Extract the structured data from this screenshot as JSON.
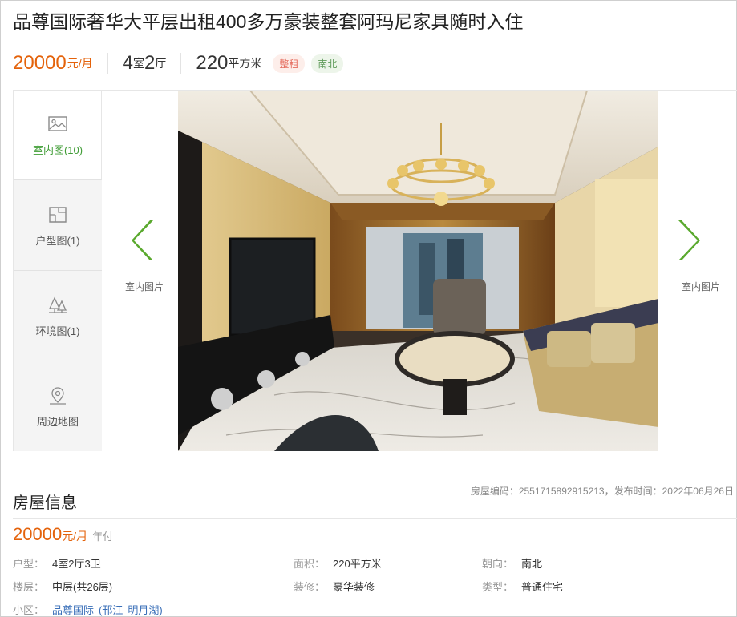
{
  "listing": {
    "title": "品尊国际奢华大平层出租400多万豪装整套阿玛尼家具随时入住",
    "price": "20000",
    "price_unit": "元/月",
    "rooms_num": "4",
    "rooms_unit1": "室",
    "halls_num": "2",
    "halls_unit": "厅",
    "area_num": "220",
    "area_unit": "平方米",
    "tags": [
      "整租",
      "南北"
    ]
  },
  "gallery": {
    "tabs": [
      {
        "label": "室内图(10)",
        "icon": "image-icon",
        "active": true
      },
      {
        "label": "户型图(1)",
        "icon": "floorplan-icon",
        "active": false
      },
      {
        "label": "环境图(1)",
        "icon": "trees-icon",
        "active": false
      },
      {
        "label": "周边地图",
        "icon": "map-pin-icon",
        "active": false
      }
    ],
    "prev_caption": "室内图片",
    "next_caption": "室内图片",
    "arrow_color": "#5aa92e",
    "photo_alt": "客厅室内照片"
  },
  "info": {
    "section_title": "房屋信息",
    "meta": "房屋编码：2551715892915213，发布时间：2022年06月26日",
    "price": "20000",
    "price_unit": "元/月",
    "pay_method": "年付",
    "rows": [
      [
        {
          "key": "户型：",
          "value": "4室2厅3卫"
        },
        {
          "key": "面积：",
          "value": "220平方米"
        },
        {
          "key": "朝向：",
          "value": "南北"
        }
      ],
      [
        {
          "key": "楼层：",
          "value": "中层(共26层)"
        },
        {
          "key": "装修：",
          "value": "豪华装修"
        },
        {
          "key": "类型：",
          "value": "普通住宅"
        }
      ]
    ],
    "community_key": "小区：",
    "community_links": [
      "品尊国际",
      "(邗江",
      "明月湖)"
    ]
  },
  "colors": {
    "accent_orange": "#e4620a",
    "accent_green": "#3f9c35",
    "link_blue": "#3a6fb8"
  }
}
